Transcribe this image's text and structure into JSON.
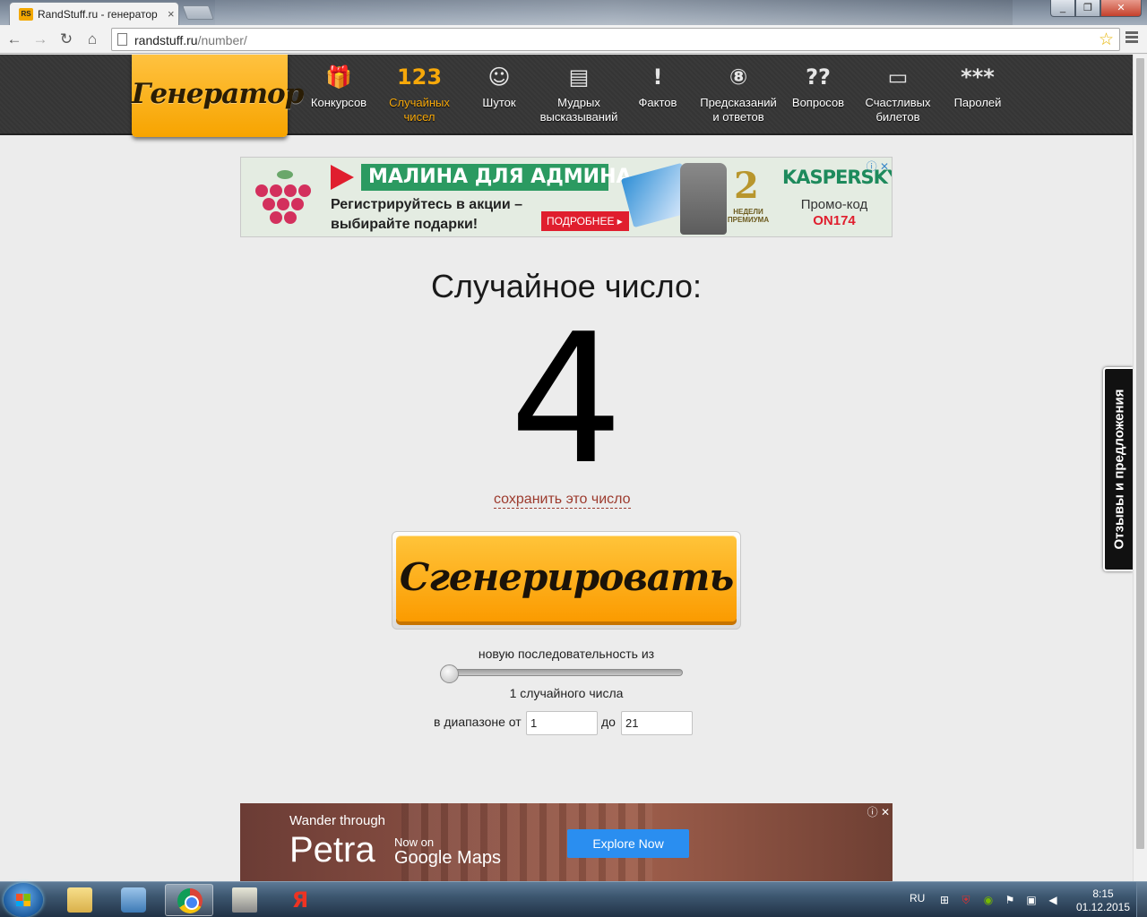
{
  "browser": {
    "tab_title": "RandStuff.ru - генератор",
    "tab_favicon_text": "RS",
    "url_host": "randstuff.ru",
    "url_path": "/number/"
  },
  "site": {
    "logo": "Генератор",
    "nav": [
      {
        "icon": "🎁",
        "icon_name": "gift-icon",
        "label": "Конкурсов",
        "active": false
      },
      {
        "icon": "123",
        "icon_name": "numbers-icon",
        "label": "Случайных чисел",
        "active": true
      },
      {
        "icon": "☺",
        "icon_name": "smiley-icon",
        "label": "Шуток",
        "active": false
      },
      {
        "icon": "▤",
        "icon_name": "scroll-icon",
        "label": "Мудрых высказываний",
        "active": false
      },
      {
        "icon": "!",
        "icon_name": "warning-icon",
        "label": "Фактов",
        "active": false
      },
      {
        "icon": "⑧",
        "icon_name": "magic-8-ball-icon",
        "label": "Предсказаний и ответов",
        "active": false
      },
      {
        "icon": "??",
        "icon_name": "question-marks-icon",
        "label": "Вопросов",
        "active": false
      },
      {
        "icon": "▭",
        "icon_name": "ticket-icon",
        "label": "Счастливых билетов",
        "active": false
      },
      {
        "icon": "***",
        "icon_name": "password-icon",
        "label": "Паролей",
        "active": false
      }
    ]
  },
  "ad_top": {
    "headline": "МАЛИНА ДЛЯ АДМИНА",
    "text": "Регистрируйтесь в акции – выбирайте подарки!",
    "more": "ПОДРОБНЕЕ ▸",
    "badge_number": "2",
    "badge_caption": "НЕДЕЛИ ПРЕМИУМА",
    "brand": "KASPERSKY",
    "promo_label": "Промо-код",
    "promo_code": "ON174",
    "adchoice": "ⓘ ✕"
  },
  "main": {
    "title": "Случайное число:",
    "number": "4",
    "save_link": "сохранить это число",
    "generate_button": "Сгенерировать",
    "sequence_label": "новую последовательность из",
    "slider_value": 1,
    "count_label": "1 случайного числа",
    "range_from_label": "в диапазоне от",
    "range_from_value": "1",
    "range_to_label": "до",
    "range_to_value": "21"
  },
  "feedback_tab": "Отзывы и предложения",
  "ad_bottom": {
    "line1": "Wander through",
    "big": "Petra",
    "now_on": "Now on",
    "google_maps": "Google Maps",
    "button": "Explore Now",
    "adchoice": "ⓘ ✕"
  },
  "taskbar": {
    "language": "RU",
    "time": "8:15",
    "date": "01.12.2015",
    "apps": [
      "folder-icon",
      "sound-icon",
      "chrome-icon",
      "game-icon",
      "yandex-icon"
    ],
    "yandex_glyph": "Я"
  },
  "colors": {
    "accent_orange": "#f7a400",
    "nav_active": "#f6a80a",
    "header_bg": "#383838",
    "link_red": "#9c3a2d"
  }
}
